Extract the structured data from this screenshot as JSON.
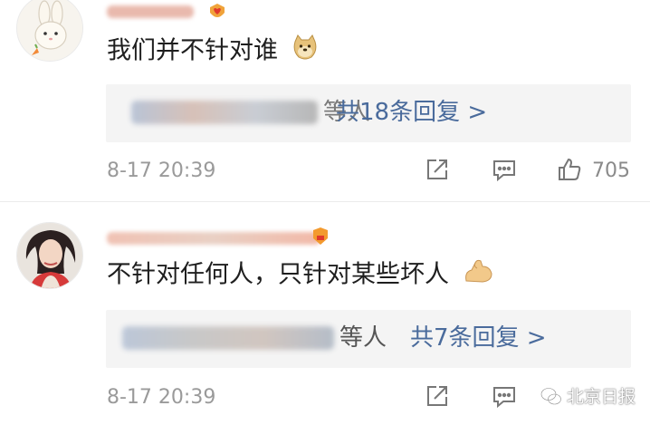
{
  "comments": [
    {
      "text": "我们并不针对谁",
      "emoji": "doge-emoji",
      "reply_suffix": "等人",
      "reply_count": "共18条回复 >",
      "timestamp": "8-17 20:39",
      "like_count": "705"
    },
    {
      "text": "不针对任何人，只针对某些坏人",
      "emoji": "flexed-biceps-emoji",
      "reply_suffix": "等人",
      "reply_count": "共7条回复 >",
      "timestamp": "8-17 20:39",
      "like_count": ""
    }
  ],
  "watermark": {
    "text": "北京日报"
  },
  "icons": {
    "share": "share-icon",
    "comment": "comment-icon",
    "like": "like-icon"
  },
  "colors": {
    "link_blue": "#4a6b9c",
    "reply_background": "#f4f4f4",
    "meta_gray": "#9a9a9a"
  }
}
